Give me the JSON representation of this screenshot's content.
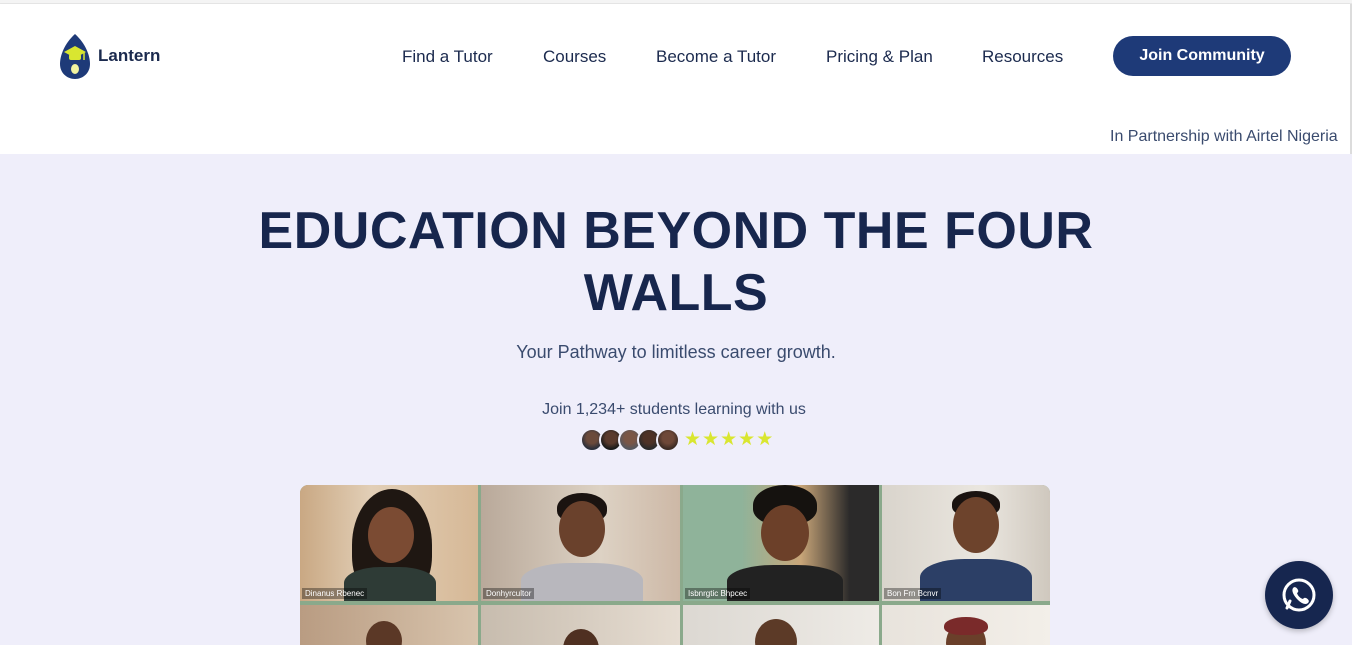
{
  "brand": {
    "name": "Lantern",
    "accent": "#1e3a78",
    "text_dark": "#17264d",
    "star_color": "#d9e630"
  },
  "nav": {
    "items": [
      {
        "label": "Find a Tutor"
      },
      {
        "label": "Courses"
      },
      {
        "label": "Become a Tutor"
      },
      {
        "label": "Pricing & Plan"
      },
      {
        "label": "Resources"
      }
    ],
    "cta_label": "Join Community"
  },
  "ticker": {
    "text": "In Partnership with Airtel Nigeria"
  },
  "hero": {
    "title": "EDUCATION BEYOND THE FOUR WALLS",
    "subtitle": "Your Pathway to limitless career growth.",
    "students_line": "Join 1,234+ students learning with us",
    "rating": 5
  },
  "video_grid": {
    "participants": [
      {
        "name_tag": "Dinanus Rbenec"
      },
      {
        "name_tag": "Donhyrcultor"
      },
      {
        "name_tag": "Isbnrgtic Bhpcec"
      },
      {
        "name_tag": "Bon Frn Bcnvr"
      }
    ]
  },
  "icons": {
    "logo": "lantern-graduation-cap-icon",
    "chat": "phone-chat-icon",
    "star": "star-icon"
  }
}
